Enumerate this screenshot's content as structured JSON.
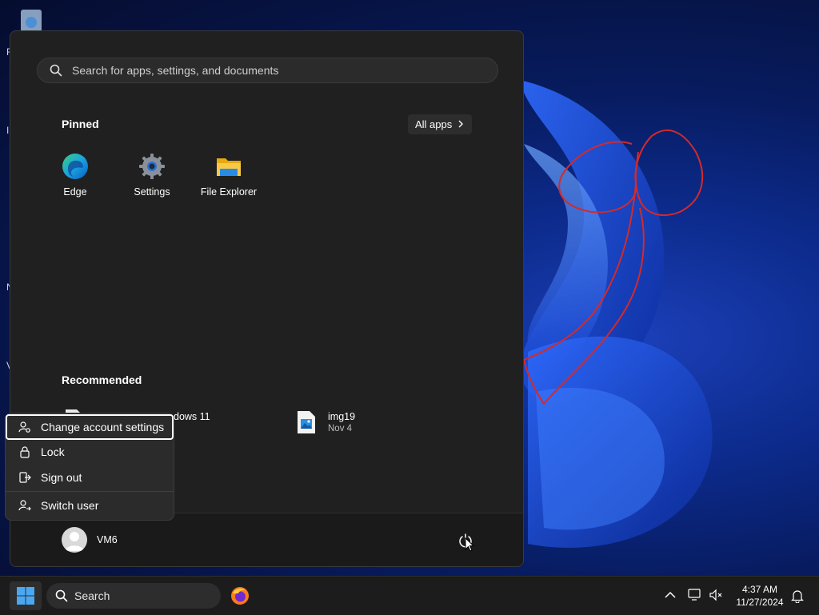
{
  "start_menu": {
    "search_placeholder": "Search for apps, settings, and documents",
    "pinned_title": "Pinned",
    "all_apps_label": "All apps",
    "pinned": [
      {
        "label": "Edge",
        "icon": "edge-icon"
      },
      {
        "label": "Settings",
        "icon": "settings-gear-icon"
      },
      {
        "label": "File Explorer",
        "icon": "folder-icon"
      }
    ],
    "recommended_title": "Recommended",
    "recommended": [
      {
        "name": "dows 11",
        "sub": "",
        "icon": "document-icon"
      },
      {
        "name": "img19",
        "sub": "Nov 4",
        "icon": "image-file-icon"
      }
    ],
    "user": {
      "name": "VM6"
    }
  },
  "account_menu": {
    "items": [
      {
        "label": "Change account settings",
        "icon": "person-gear-icon",
        "focused": true
      },
      {
        "label": "Lock",
        "icon": "lock-icon"
      },
      {
        "label": "Sign out",
        "icon": "sign-out-icon"
      },
      {
        "label": "Switch user",
        "icon": "switch-user-icon"
      }
    ]
  },
  "taskbar": {
    "search_label": "Search",
    "clock": {
      "time": "4:37 AM",
      "date": "11/27/2024"
    }
  },
  "colors": {
    "menu_bg": "#202020",
    "annotation": "#d42a2a",
    "accent": "#4aa0f0"
  }
}
